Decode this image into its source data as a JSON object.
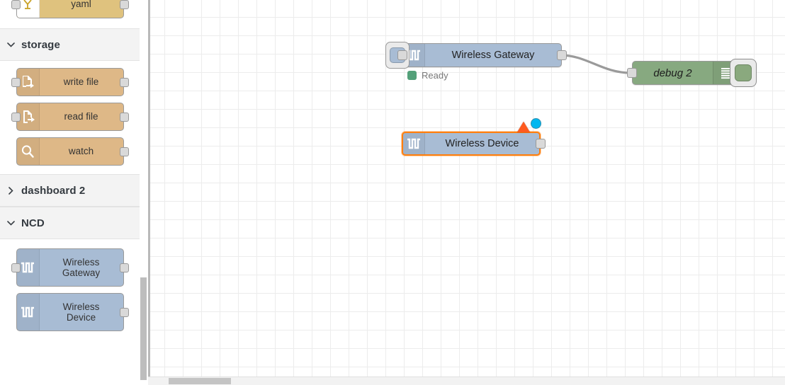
{
  "palette": {
    "top_partial_node": {
      "label": "yaml",
      "icon": "yaml-icon",
      "color": "#dfc27e",
      "has_input": true,
      "has_output": true
    },
    "sections": [
      {
        "title": "storage",
        "expanded": true,
        "chevron": "chevron-down-icon",
        "nodes": [
          {
            "label": "write file",
            "icon": "file-write-icon",
            "color": "#deb887",
            "has_input": true,
            "has_output": true
          },
          {
            "label": "read file",
            "icon": "file-read-icon",
            "color": "#deb887",
            "has_input": true,
            "has_output": true
          },
          {
            "label": "watch",
            "icon": "magnifier-icon",
            "color": "#deb887",
            "has_input": false,
            "has_output": true
          }
        ]
      },
      {
        "title": "dashboard 2",
        "expanded": false,
        "chevron": "chevron-right-icon",
        "nodes": []
      },
      {
        "title": "NCD",
        "expanded": true,
        "chevron": "chevron-down-icon",
        "nodes": [
          {
            "label_line1": "Wireless",
            "label_line2": "Gateway",
            "icon": "pulse-wave-icon",
            "color": "#a8bcd4",
            "has_input": true,
            "has_output": true
          },
          {
            "label_line1": "Wireless",
            "label_line2": "Device",
            "icon": "pulse-wave-icon",
            "color": "#a8bcd4",
            "has_input": false,
            "has_output": true
          }
        ]
      }
    ],
    "scrollbar": {
      "name": "palette-vertical-scrollbar"
    }
  },
  "canvas": {
    "grid_size": 26,
    "horizontal_scrollbar": {
      "name": "canvas-horizontal-scrollbar"
    },
    "nodes": [
      {
        "id": "wireless-gateway",
        "label": "Wireless Gateway",
        "icon": "pulse-wave-icon",
        "color": "#a8bcd4",
        "selected": false,
        "has_left_button": true,
        "has_input": true,
        "has_output": true,
        "status": {
          "text": "Ready",
          "color": "#53a079"
        }
      },
      {
        "id": "debug-2",
        "label": "debug 2",
        "icon": "debug-lines-icon",
        "color": "#87a980",
        "selected": false,
        "has_right_button": true,
        "button_active": true,
        "has_input": true,
        "has_output": false,
        "italic": true
      },
      {
        "id": "wireless-device",
        "label": "Wireless Device",
        "icon": "pulse-wave-icon",
        "color": "#a8bcd4",
        "selected": true,
        "has_input": false,
        "has_output": true,
        "badges": [
          {
            "type": "warning-triangle",
            "color": "#ff5a1f"
          },
          {
            "type": "changed-dot",
            "color": "#00b7f0"
          }
        ]
      }
    ],
    "wires": [
      {
        "from": "wireless-gateway",
        "to": "debug-2",
        "color": "#9a9a9a"
      }
    ]
  }
}
